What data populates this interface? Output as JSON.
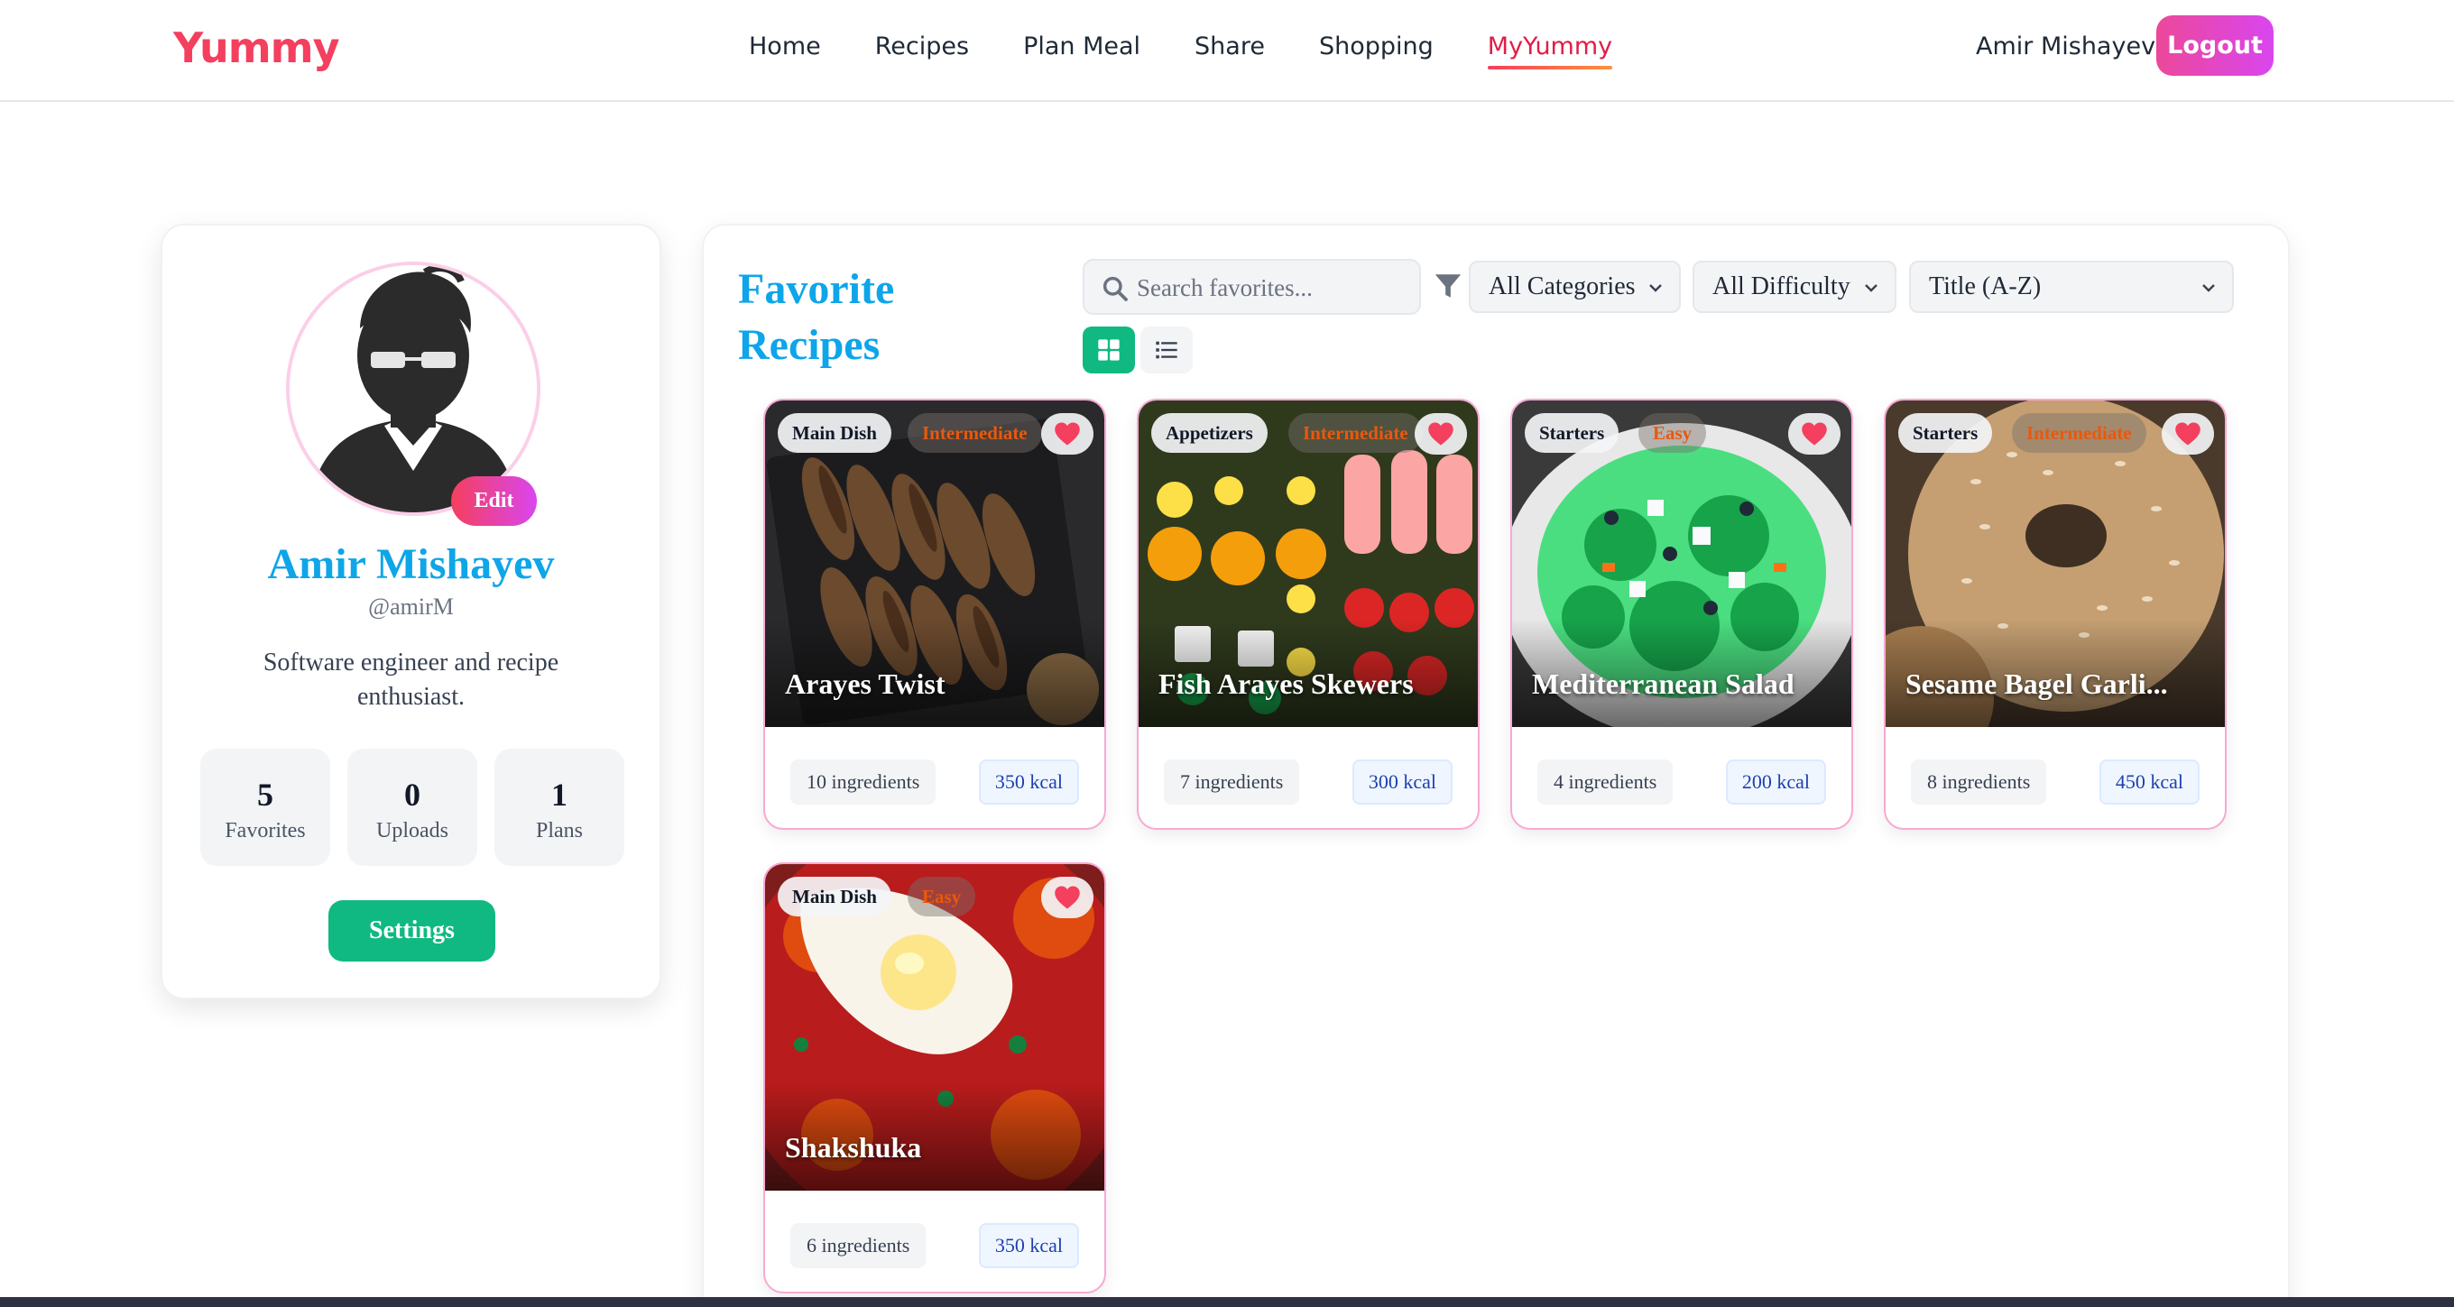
{
  "header": {
    "logo": "Yummy",
    "nav": [
      "Home",
      "Recipes",
      "Plan Meal",
      "Share",
      "Shopping",
      "MyYummy"
    ],
    "active_nav": "MyYummy",
    "user_name": "Amir Mishayev",
    "logout_label": "Logout"
  },
  "profile": {
    "name": "Amir Mishayev",
    "handle": "@amirM",
    "bio": "Software engineer and recipe enthusiast.",
    "edit_label": "Edit",
    "stats": [
      {
        "value": "5",
        "label": "Favorites"
      },
      {
        "value": "0",
        "label": "Uploads"
      },
      {
        "value": "1",
        "label": "Plans"
      }
    ],
    "settings_label": "Settings"
  },
  "favorites": {
    "title": "Favorite Recipes",
    "search_placeholder": "Search favorites...",
    "category_select": "All Categories",
    "difficulty_select": "All Difficulty",
    "sort_select": "Title (A-Z)",
    "recipes": [
      {
        "title": "Arayes Twist",
        "category": "Main Dish",
        "difficulty": "Intermediate",
        "ingredients": "10 ingredients",
        "kcal": "350 kcal",
        "favorited": true
      },
      {
        "title": "Fish Arayes Skewers",
        "category": "Appetizers",
        "difficulty": "Intermediate",
        "ingredients": "7 ingredients",
        "kcal": "300 kcal",
        "favorited": true
      },
      {
        "title": "Mediterranean Salad",
        "category": "Starters",
        "difficulty": "Easy",
        "ingredients": "4 ingredients",
        "kcal": "200 kcal",
        "favorited": true
      },
      {
        "title": "Sesame Bagel Garli...",
        "category": "Starters",
        "difficulty": "Intermediate",
        "ingredients": "8 ingredients",
        "kcal": "450 kcal",
        "favorited": true
      },
      {
        "title": "Shakshuka",
        "category": "Main Dish",
        "difficulty": "Easy",
        "ingredients": "6 ingredients",
        "kcal": "350 kcal",
        "favorited": true
      }
    ]
  },
  "colors": {
    "accent_blue": "#0ea5e9",
    "accent_green": "#10b981",
    "accent_pink": "#ec4899",
    "heart_red": "#f43f5e"
  },
  "icons": [
    "search-icon",
    "filter-icon",
    "chevron-down-icon",
    "grid-view-icon",
    "list-view-icon",
    "heart-icon",
    "avatar-icon"
  ]
}
